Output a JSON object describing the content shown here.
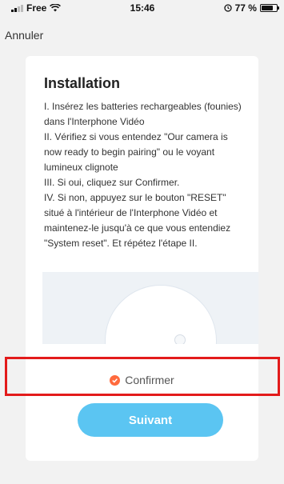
{
  "status_bar": {
    "carrier": "Free",
    "time": "15:46",
    "battery_text": "77 %",
    "battery_level": 0.77
  },
  "nav": {
    "cancel_label": "Annuler"
  },
  "card": {
    "title": "Installation",
    "steps": [
      "I.  Insérez les batteries rechargeables (founies) dans l'Interphone Vidéo",
      "II. Vérifiez si vous entendez \"Our camera is now ready to begin pairing\" ou le voyant lumineux clignote",
      "III. Si oui, cliquez sur Confirmer.",
      "IV. Si non, appuyez sur le bouton \"RESET\" situé à l'intérieur de l'Interphone Vidéo et maintenez-le jusqu'à ce que vous entendiez \"System reset\". Et répétez l'étape II."
    ],
    "confirm_label": "Confirmer",
    "next_label": "Suivant"
  },
  "colors": {
    "accent": "#5bc5f2",
    "check": "#ff6a3d",
    "highlight": "#e31b1b"
  }
}
